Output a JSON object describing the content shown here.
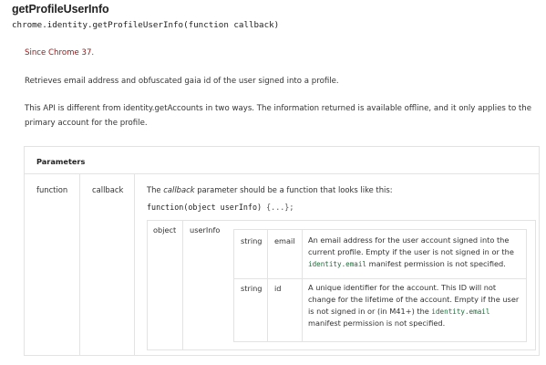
{
  "header": {
    "title": "getProfileUserInfo",
    "signature": "chrome.identity.getProfileUserInfo(function callback)"
  },
  "since": "Since Chrome 37.",
  "paragraphs": [
    "Retrieves email address and obfuscated gaia id of the user signed into a profile.",
    "This API is different from identity.getAccounts in two ways. The information returned is available offline, and it only applies to the primary account for the profile."
  ],
  "parameters": {
    "heading": "Parameters",
    "row": {
      "type": "function",
      "name": "callback",
      "desc_prefix": "The ",
      "desc_em": "callback",
      "desc_suffix": " parameter should be a function that looks like this:",
      "code": "function(object userInfo)",
      "code_body": " {...};",
      "object": {
        "type": "object",
        "name": "userInfo",
        "properties": [
          {
            "type": "string",
            "name": "email",
            "desc_before": "An email address for the user account signed into the current profile. Empty if the user is not signed in or the ",
            "desc_code": "identity.email",
            "desc_after": " manifest permission is not specified."
          },
          {
            "type": "string",
            "name": "id",
            "desc_before": "A unique identifier for the account. This ID will not change for the lifetime of the account. Empty if the user is not signed in or (in M41+) the ",
            "desc_code": "identity.email",
            "desc_after": " manifest permission is not specified."
          }
        ]
      }
    }
  },
  "colors": {
    "since": "#8b1a1a",
    "border": "#e3e3e3",
    "code_green": "#1f6b3a"
  }
}
